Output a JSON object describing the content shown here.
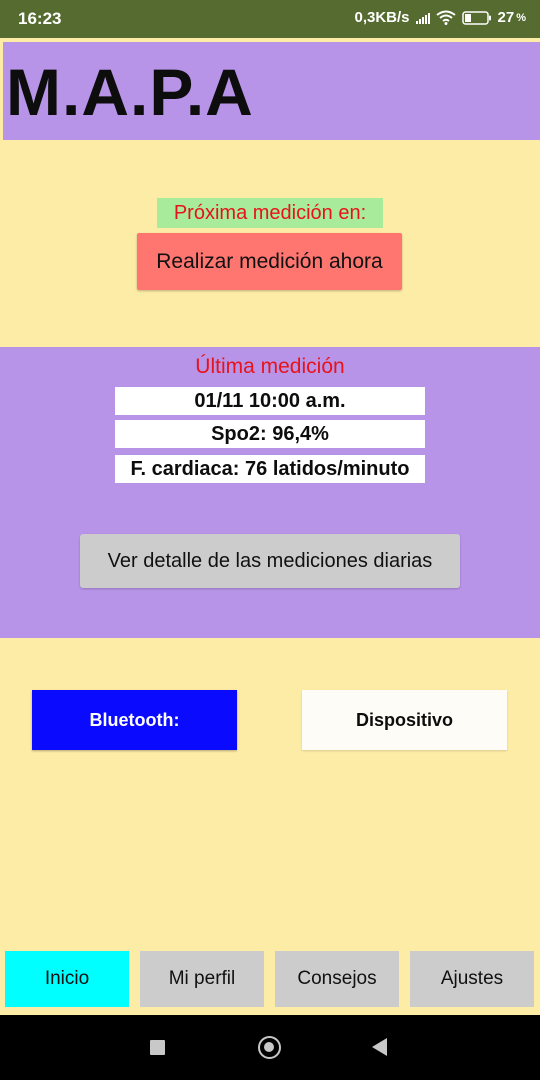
{
  "status_bar": {
    "time": "16:23",
    "network_speed": "0,3KB/s",
    "battery_percent": "27",
    "battery_unit": "%",
    "icons": [
      "signal-icon",
      "wifi-icon",
      "battery-icon"
    ]
  },
  "header": {
    "title": "M.A.P.A"
  },
  "next_measurement": {
    "label": "Próxima medición en:",
    "button_label": "Realizar medición ahora"
  },
  "last_measurement": {
    "title": "Última medición",
    "datetime": "01/11 10:00 a.m.",
    "spo2": "Spo2: 96,4%",
    "heart_rate": "F. cardiaca: 76 latidos/minuto",
    "detail_button_label": "Ver detalle de las mediciones diarias"
  },
  "connection": {
    "bluetooth_label": "Bluetooth:",
    "device_label": "Dispositivo"
  },
  "tabs": [
    {
      "label": "Inicio",
      "active": true
    },
    {
      "label": "Mi perfil",
      "active": false
    },
    {
      "label": "Consejos",
      "active": false
    },
    {
      "label": "Ajustes",
      "active": false
    }
  ],
  "colors": {
    "background": "#fdeca6",
    "panel": "#b794e8",
    "status_bar": "#556b2f",
    "accent_red": "#e8131a",
    "bluetooth_blue": "#0a0aff",
    "active_tab": "#00ffff",
    "measure_button": "#ff7570"
  }
}
